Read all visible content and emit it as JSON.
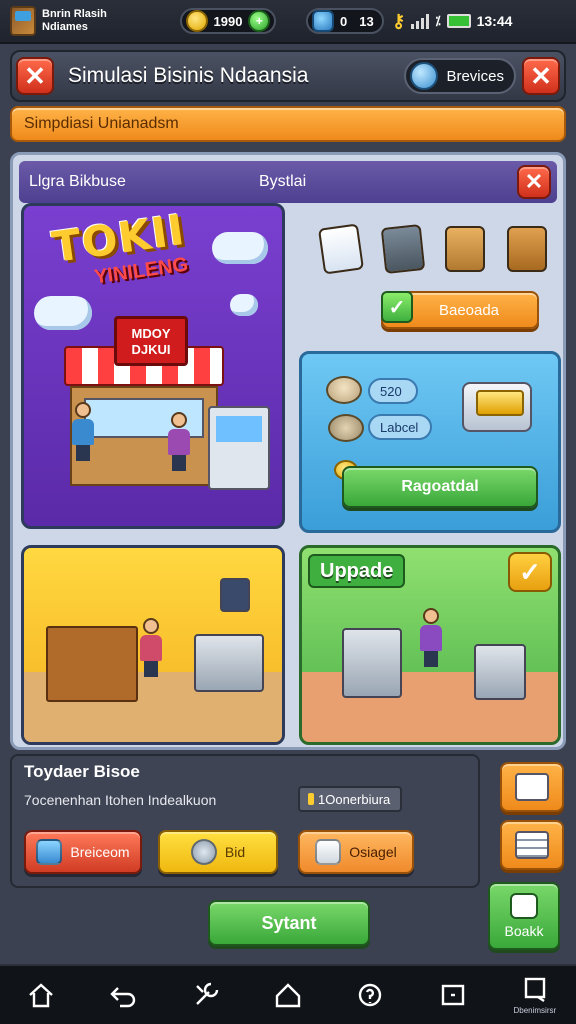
{
  "status_bar": {
    "app_title_line1": "Bnrin Rlasih",
    "app_title_line2": "Ndiames",
    "coins": "1990",
    "currency2": "0",
    "currency3": "13",
    "clock": "13:44"
  },
  "title_bar": {
    "title": "Simulasi Bisinis Ndaansia",
    "browse_label": "Brevices"
  },
  "banner": {
    "text": "Simpdiasi Unianadsm"
  },
  "panel": {
    "header_left": "Llgra Bikbuse",
    "header_right": "Bystlai",
    "shop_title": "TOKII",
    "shop_subtitle": "YINILENG",
    "store_sign_line1": "MDOY",
    "store_sign_line2": "DJKUI",
    "top_button": "Baeoada",
    "blue_card": {
      "value": "520",
      "label": "Labcel",
      "button": "Ragoatdal"
    },
    "upgrade_label": "Uppade"
  },
  "info": {
    "title": "Toydaer Bisoe",
    "subtitle": "7ocenenhan Itohen Indealkuon",
    "pill": "1Oonerbiura",
    "buttons": {
      "red": "Breiceom",
      "yellow": "Bid",
      "orange": "Osiagel"
    }
  },
  "start_button": "Sytant",
  "stock_button": "Boakk",
  "nav": {
    "last_label": "Dbenimsirsr"
  },
  "icons": {
    "nav": [
      "home-icon",
      "back-icon",
      "tools-icon",
      "house-icon",
      "support-icon",
      "window-icon",
      "profile-icon"
    ]
  },
  "colors": {
    "accent_orange": "#ef8a1c",
    "accent_green": "#3aa83a",
    "accent_red": "#d0301c",
    "panel_purple": "#5a2aa8"
  }
}
